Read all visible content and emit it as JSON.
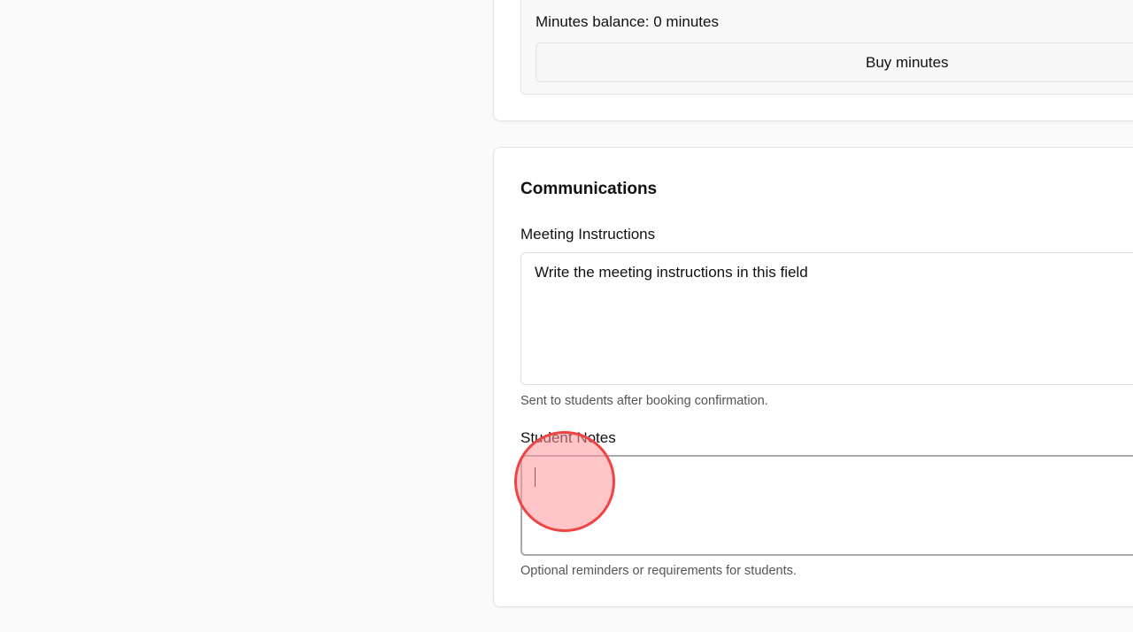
{
  "billing": {
    "balance_text": "Minutes balance: 0 minutes",
    "buy_label": "Buy minutes"
  },
  "communications": {
    "title": "Communications",
    "meeting_instructions": {
      "label": "Meeting Instructions",
      "value": "Write the meeting instructions in this field",
      "helper": "Sent to students after booking confirmation."
    },
    "student_notes": {
      "label": "Student Notes",
      "value": "",
      "helper": "Optional reminders or requirements for students."
    }
  },
  "colors": {
    "page_background": "#fafafa",
    "card_background": "#ffffff",
    "focus_border": "#a8a8ad",
    "click_indicator": "#ef4444"
  }
}
